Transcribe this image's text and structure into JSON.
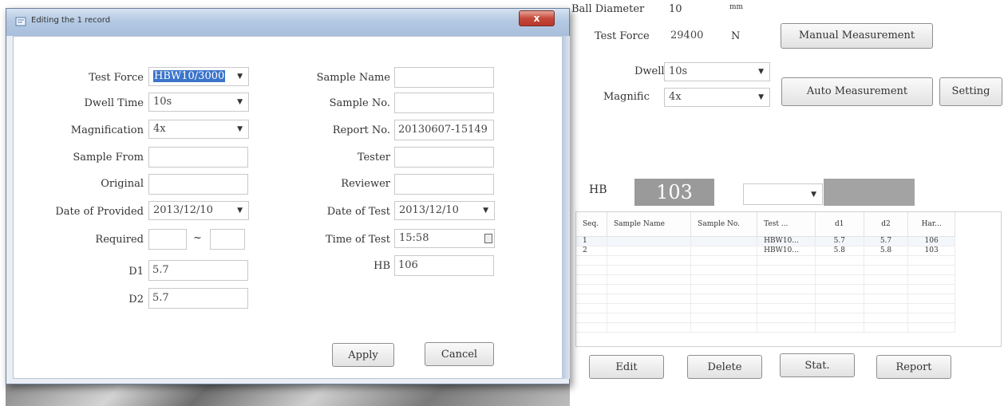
{
  "dialog": {
    "title": "Editing the 1 record",
    "close_label": "x",
    "left": {
      "test_force_label": "Test Force",
      "test_force_value": "HBW10/3000",
      "dwell_time_label": "Dwell Time",
      "dwell_time_value": "10s",
      "magnification_label": "Magnification",
      "magnification_value": "4x",
      "sample_from_label": "Sample From",
      "sample_from_value": "",
      "original_label": "Original",
      "original_value": "",
      "date_provided_label": "Date of Provided",
      "date_provided_value": "2013/12/10",
      "required_label": "Required",
      "required_from": "",
      "required_sep": "~",
      "required_to": "",
      "d1_label": "D1",
      "d1_value": "5.7",
      "d2_label": "D2",
      "d2_value": "5.7"
    },
    "right": {
      "sample_name_label": "Sample Name",
      "sample_name_value": "",
      "sample_no_label": "Sample No.",
      "sample_no_value": "",
      "report_no_label": "Report No.",
      "report_no_value": "20130607-15149",
      "tester_label": "Tester",
      "tester_value": "",
      "reviewer_label": "Reviewer",
      "reviewer_value": "",
      "date_test_label": "Date of Test",
      "date_test_value": "2013/12/10",
      "time_test_label": "Time of Test",
      "time_test_value": "15:58",
      "hb_label": "HB",
      "hb_value": "106"
    },
    "apply_label": "Apply",
    "cancel_label": "Cancel"
  },
  "main": {
    "ball_diameter_label": "Ball Diameter",
    "ball_diameter_value": "10",
    "ball_diameter_unit": "mm",
    "test_force_label": "Test Force",
    "test_force_value": "29400",
    "test_force_unit": "N",
    "manual_measurement_label": "Manual Measurement",
    "dwell_label": "Dwell",
    "dwell_value": "10s",
    "auto_measurement_label": "Auto Measurement",
    "setting_label": "Setting",
    "magnific_label": "Magnific",
    "magnific_value": "4x",
    "hb_label": "HB",
    "hb_value": "103",
    "hb_combo_value": "",
    "grid": {
      "columns": [
        "Seq.",
        "Sample Name",
        "Sample No.",
        "Test ...",
        "d1",
        "d2",
        "Har..."
      ],
      "rows": [
        [
          "1",
          "",
          "",
          "HBW10...",
          "5.7",
          "5.7",
          "106"
        ],
        [
          "2",
          "",
          "",
          "HBW10...",
          "5.8",
          "5.8",
          "103"
        ]
      ]
    },
    "edit_label": "Edit",
    "delete_label": "Delete",
    "stat_label": "Stat.",
    "report_label": "Report"
  }
}
